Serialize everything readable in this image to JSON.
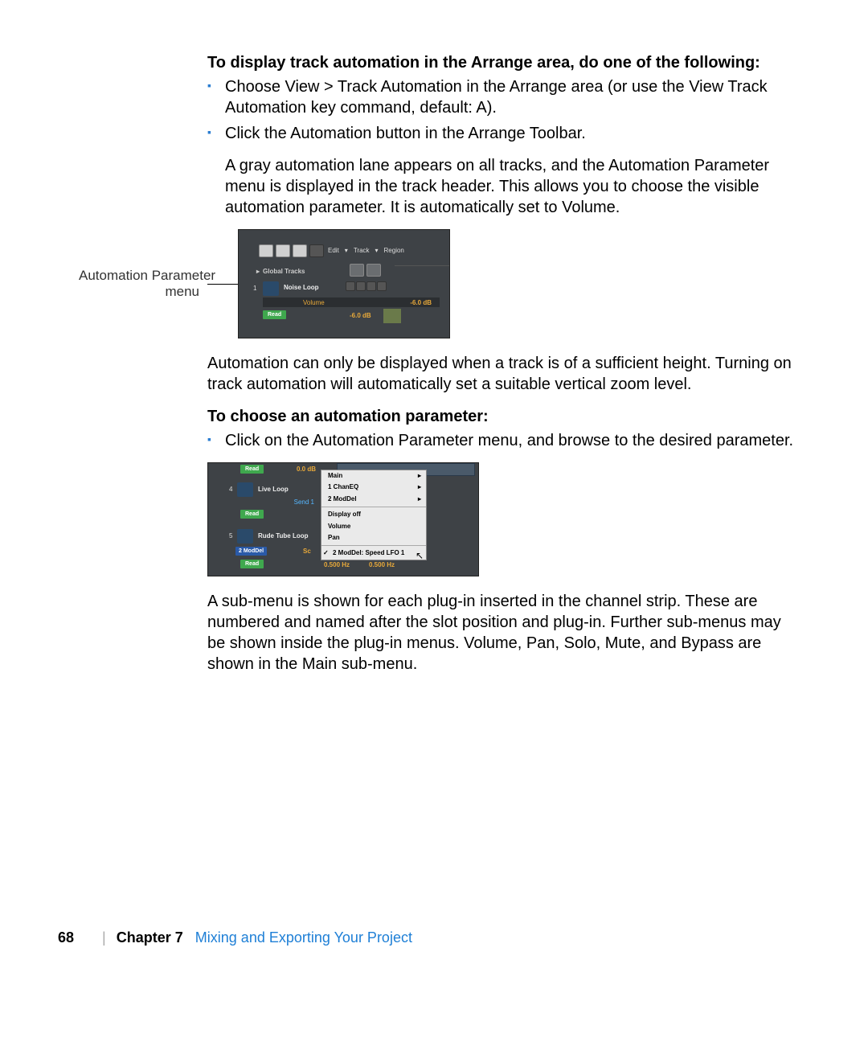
{
  "heading1": "To display track automation in the Arrange area, do one of the following:",
  "bullet1a": "Choose View > Track Automation in the Arrange area (or use the View Track Automation key command, default:  A).",
  "bullet1b": "Click the Automation button in the Arrange Toolbar.",
  "para_gray_indent": "A gray automation lane appears on all tracks, and the Automation Parameter menu is displayed in the track header. This allows you to choose the visible automation parameter. It is automatically set to Volume.",
  "callout": {
    "line1": "Automation Parameter",
    "line2": "menu"
  },
  "fig1": {
    "edit": "Edit",
    "track": "Track",
    "region": "Region",
    "global_tracks": "Global Tracks",
    "track_num": "1",
    "track_name": "Noise Loop",
    "volume": "Volume",
    "db": "-6.0 dB",
    "read": "Read",
    "db2": "-6.0 dB"
  },
  "para_sufficient": "Automation can only be displayed when a track is of a sufficient height. Turning on track automation will automatically set a suitable vertical zoom level.",
  "heading2": "To choose an automation parameter:",
  "bullet2": "Click on the Automation Parameter menu, and browse to the desired parameter.",
  "fig2": {
    "read": "Read",
    "db_top": "0.0 dB",
    "tnum4": "4",
    "live_loop": "Live Loop",
    "send1": "Send 1",
    "tnum5": "5",
    "rude_tube": "Rude Tube Loop",
    "moddel_label": "2 ModDel",
    "sc": "Sc",
    "hz1": "0.500 Hz",
    "hz2": "0.500 Hz",
    "menu": {
      "main": "Main",
      "chaneq": "1 ChanEQ",
      "moddel": "2 ModDel",
      "display_off": "Display off",
      "volume": "Volume",
      "pan": "Pan",
      "selected": "2 ModDel: Speed LFO 1"
    }
  },
  "para_submenu": "A sub-menu is shown for each plug-in inserted in the channel strip. These are numbered and named after the slot position and plug-in. Further sub-menus may be shown inside the plug-in menus. Volume, Pan, Solo, Mute, and Bypass are shown in the Main sub-menu.",
  "footer": {
    "page": "68",
    "chapter": "Chapter 7",
    "title": "Mixing and Exporting Your Project"
  }
}
